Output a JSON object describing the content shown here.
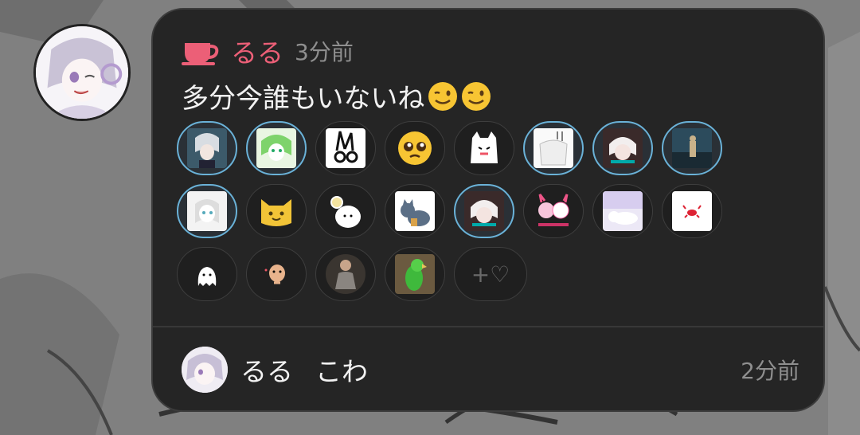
{
  "note": {
    "username": "るる",
    "time": "3分前",
    "text": "多分今誰もいないね",
    "emojis": [
      "wink-emoji",
      "wink-emoji"
    ]
  },
  "reactions": {
    "row1": [
      "sticker-anime-boy",
      "sticker-green-boy",
      "sticker-rabbit",
      "pleading-face-emoji",
      "sticker-white-cat",
      "sticker-manga-panel",
      "sticker-white-hair-boy",
      "sticker-scene"
    ],
    "row2": [
      "sticker-girl-sketch",
      "sticker-yellow-cat",
      "sticker-white-blob",
      "sticker-grey-cat",
      "sticker-white-hair-boy-2",
      "sticker-pink-bunnies",
      "sticker-lying-cat",
      "sticker-crab"
    ],
    "row3": [
      "sticker-ghost",
      "sticker-potato",
      "sticker-man",
      "sticker-parrot"
    ],
    "add_label": "+♡"
  },
  "reply": {
    "username": "るる",
    "text": "こわ",
    "time": "2分前"
  },
  "colors": {
    "accent": "#ec5f77",
    "active_border": "#6ab2d8",
    "card_bg": "#252525"
  }
}
